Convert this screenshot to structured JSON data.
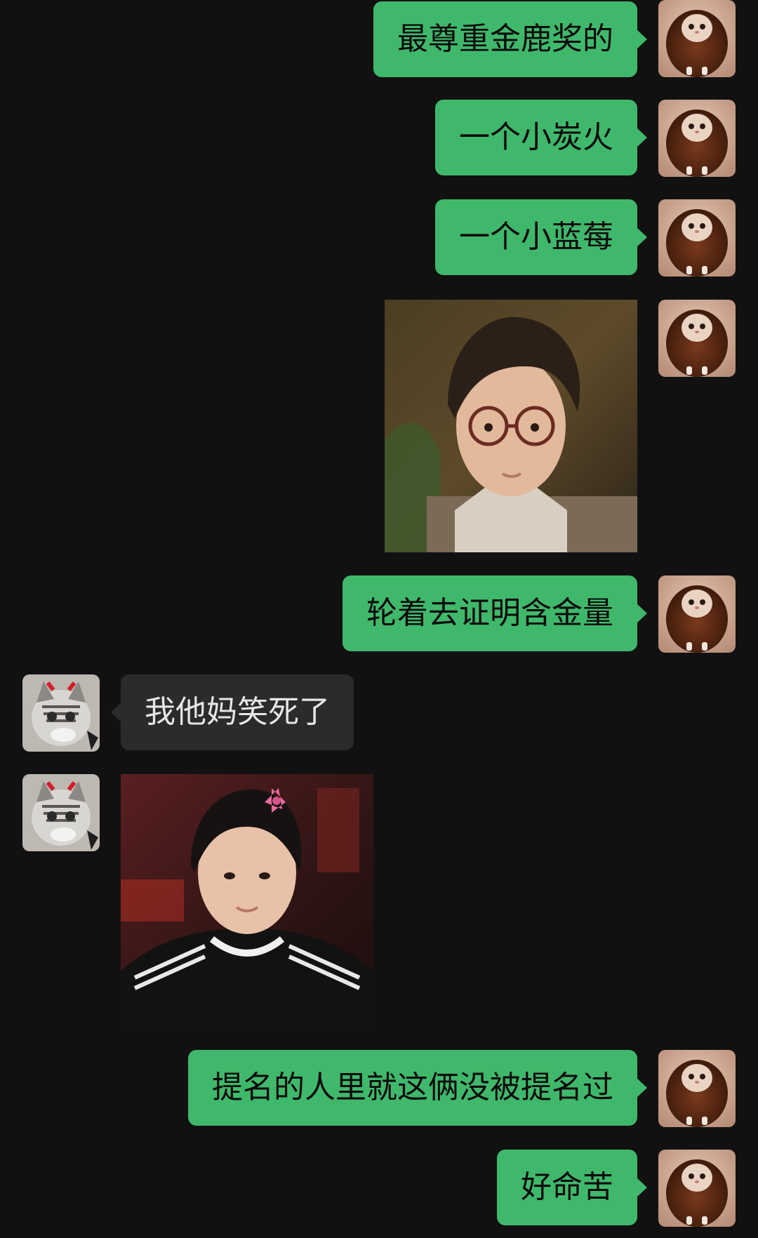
{
  "messages": [
    {
      "sender": "me",
      "type": "text",
      "text": "最尊重金鹿奖的"
    },
    {
      "sender": "me",
      "type": "text",
      "text": "一个小炭火"
    },
    {
      "sender": "me",
      "type": "text",
      "text": "一个小蓝莓"
    },
    {
      "sender": "me",
      "type": "image",
      "image_icon": "photo-man-with-glasses"
    },
    {
      "sender": "me",
      "type": "text",
      "text": "轮着去证明含金量"
    },
    {
      "sender": "other",
      "type": "text",
      "text": "我他妈笑死了"
    },
    {
      "sender": "other",
      "type": "image",
      "image_icon": "photo-young-man-with-pink-bow"
    },
    {
      "sender": "me",
      "type": "text",
      "text": "提名的人里就这俩没被提名过"
    },
    {
      "sender": "me",
      "type": "text",
      "text": "好命苦"
    }
  ],
  "avatars": {
    "me": "lion-cat-avatar-icon",
    "other": "tabby-cat-avatar-icon"
  },
  "colors": {
    "background": "#111111",
    "my_bubble": "#40b86b",
    "their_bubble": "#2b2b2b",
    "my_text": "#0b0b0b",
    "their_text": "#e6e6e6"
  }
}
